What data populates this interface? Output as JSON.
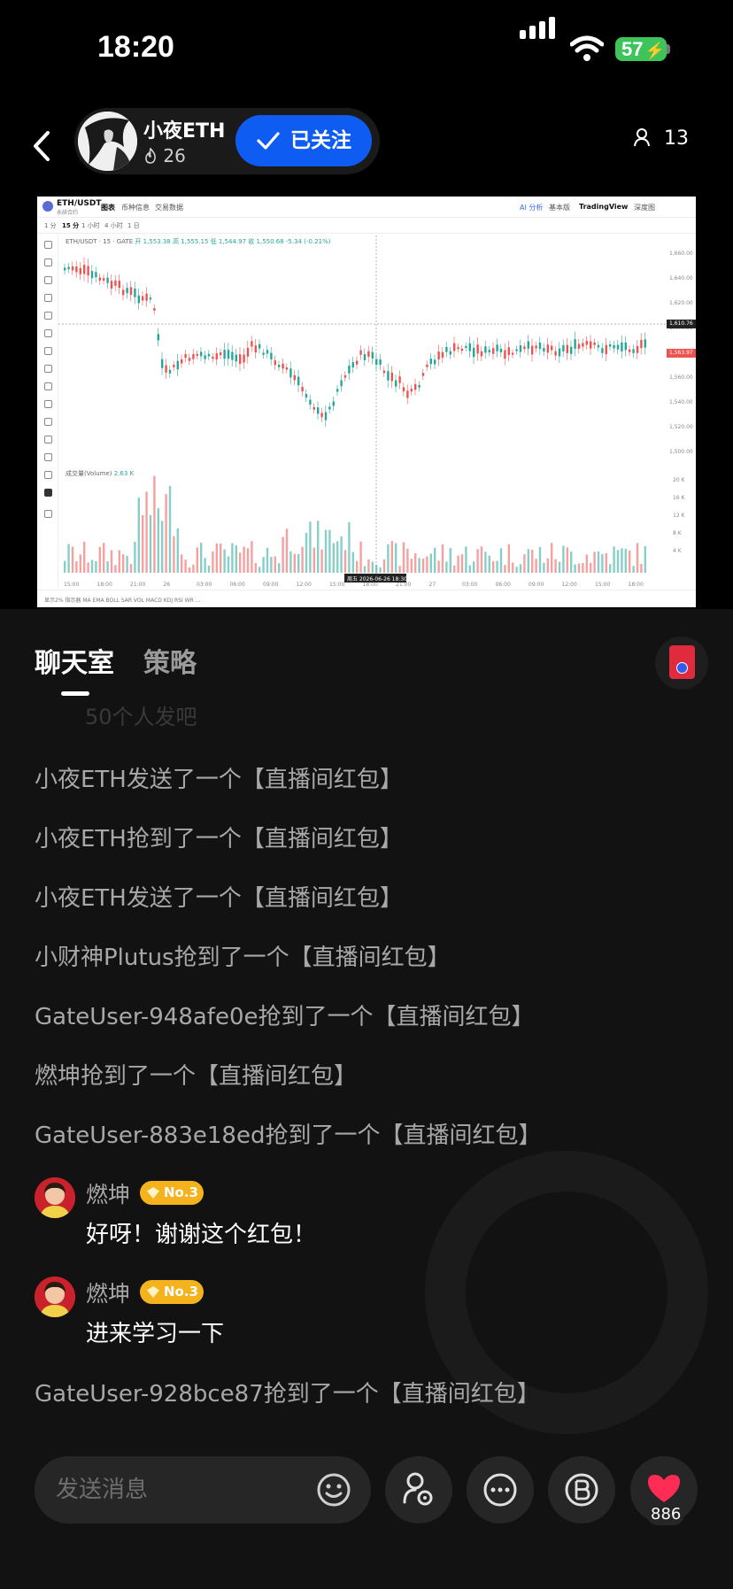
{
  "status_bar": {
    "time": "18:20",
    "battery": "57"
  },
  "header": {
    "host_name": "小夜ETH",
    "heat": "26",
    "follow_label": "已关注",
    "viewer_count": "13"
  },
  "chart": {
    "pair": "ETH/USDT",
    "pair_sub": "永续合约",
    "tabs": [
      "图表",
      "币种信息",
      "交易数据"
    ],
    "right_tabs": [
      "AI 分析",
      "基本版",
      "TradingView",
      "深度图"
    ],
    "intervals": [
      "1 分",
      "15 分",
      "1 小时",
      "4 小时",
      "1 日"
    ],
    "legend_label": "ETH/USDT · 15 · GATE",
    "legend_values": "开 1,553.38  高 1,555.15  低 1,544.97  收 1,550.68  -5.34 (-0.21%)",
    "volume_label": "成交量(Volume)",
    "volume_value": "2.63 K",
    "price_current": "1,563.97",
    "price_cross": "1,610.76",
    "crosshair_date": "周五 2026-06-26  18:30",
    "x_ticks": [
      "15:00",
      "18:00",
      "21:00",
      "26",
      "03:00",
      "06:00",
      "09:00",
      "12:00",
      "15:00",
      "18:00",
      "21:00",
      "27",
      "03:00",
      "06:00",
      "09:00",
      "12:00",
      "15:00",
      "18:00"
    ],
    "y_ticks": [
      "1,660.00",
      "1,640.00",
      "1,620.00",
      "1,600.00",
      "1,580.00",
      "1,560.00",
      "1,540.00",
      "1,520.00",
      "1,500.00"
    ],
    "vol_ticks": [
      "20 K",
      "16 K",
      "12 K",
      "8 K",
      "4 K"
    ],
    "footer": "显示2%  指示器  MA  EMA  BOLL  SAR  VOL  MACD  KDJ  RSI  WR  ..."
  },
  "tabs": {
    "chat_label": "聊天室",
    "strategy_label": "策略"
  },
  "chat": {
    "faded_line": "50个人发吧",
    "system_lines": [
      "小夜ETH发送了一个【直播间红包】",
      "小夜ETH抢到了一个【直播间红包】",
      "小夜ETH发送了一个【直播间红包】",
      "小财神Plutus抢到了一个【直播间红包】",
      "GateUser-948afe0e抢到了一个【直播间红包】",
      "燃坤抢到了一个【直播间红包】",
      "GateUser-883e18ed抢到了一个【直播间红包】"
    ],
    "messages": [
      {
        "name": "燃坤",
        "badge": "No.3",
        "text": "好呀！谢谢这个红包！"
      },
      {
        "name": "燃坤",
        "badge": "No.3",
        "text": "进来学习一下"
      }
    ],
    "last_line": "GateUser-928bce87抢到了一个【直播间红包】"
  },
  "input": {
    "placeholder": "发送消息",
    "like_count": "886"
  },
  "colors": {
    "follow_blue": "#0f5cf2",
    "badge_gold": "#f4b21d",
    "heart_red": "#ff2d55",
    "candle_up": "#26a69a",
    "candle_down": "#ef5350"
  }
}
